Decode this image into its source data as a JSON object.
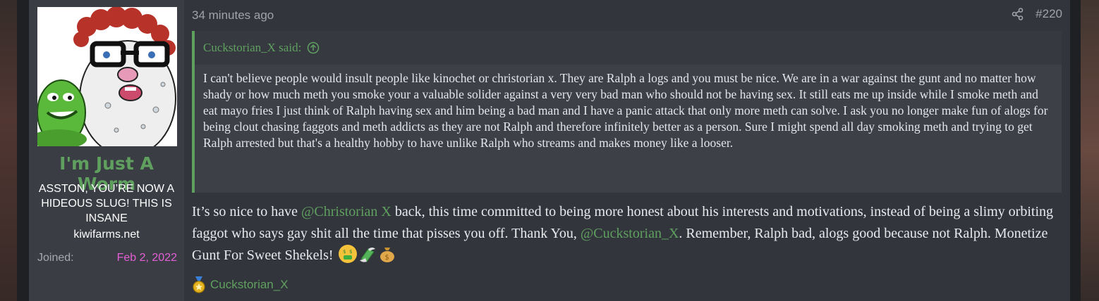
{
  "post": {
    "author": {
      "username": "I'm Just A Worm",
      "user_title": "ASSTON, YOU’RE NOW A HIDEOUS SLUG! THIS IS INSANE",
      "user_banner": "kiwifarms.net",
      "joined_label": "Joined:",
      "joined_value": "Feb 2, 2022",
      "avatar_icon": "cartoon-avatar-icon"
    },
    "attribution": "34 minutes ago",
    "post_number": "#220",
    "share_icon": "share-icon",
    "quote": {
      "author_label": "Cuckstorian_X said:",
      "jump_icon": "arrow-up-circle-icon",
      "body": "I can't believe people would insult people like kinochet or christorian x. They are Ralph a logs and you must be nice. We are in a war against the gunt and no matter how shady or how much meth you smoke your a valuable solider against a very very bad man who should not be having sex. It still eats me up inside while I smoke meth and eat mayo fries I just think of Ralph having sex and him being a bad man and I have a panic attack that only more meth can solve. I ask you no longer make fun of alogs for being clout chasing faggots and meth addicts as they are not Ralph and therefore infinitely better as a person. Sure I might spend all day smoking meth and trying to get Ralph arrested but that's a healthy hobby to have unlike Ralph who streams and makes money like a looser."
    },
    "message": {
      "part1": "It’s so nice to have ",
      "mention1": "@Christorian X",
      "part2": " back, this time committed to being more honest about his interests and motivations, instead of being a slimy orbiting faggot who says gay shit all the time that pisses you off. Thank You, ",
      "mention2": "@Cuckstorian_X",
      "part3": ". Remember, Ralph bad, alogs good because not Ralph. Monetize Gunt For Sweet Shekels!",
      "emojis": [
        "money-mouth-face-icon",
        "money-with-wings-icon",
        "money-bag-icon"
      ]
    },
    "reactions": {
      "icon": "medal-icon",
      "users": "Cuckstorian_X"
    }
  },
  "colors": {
    "accent_green": "#5fa05f",
    "joined_date_pink": "#e45fd6",
    "post_background": "#32353b",
    "user_cell_background": "#3a3d44"
  }
}
